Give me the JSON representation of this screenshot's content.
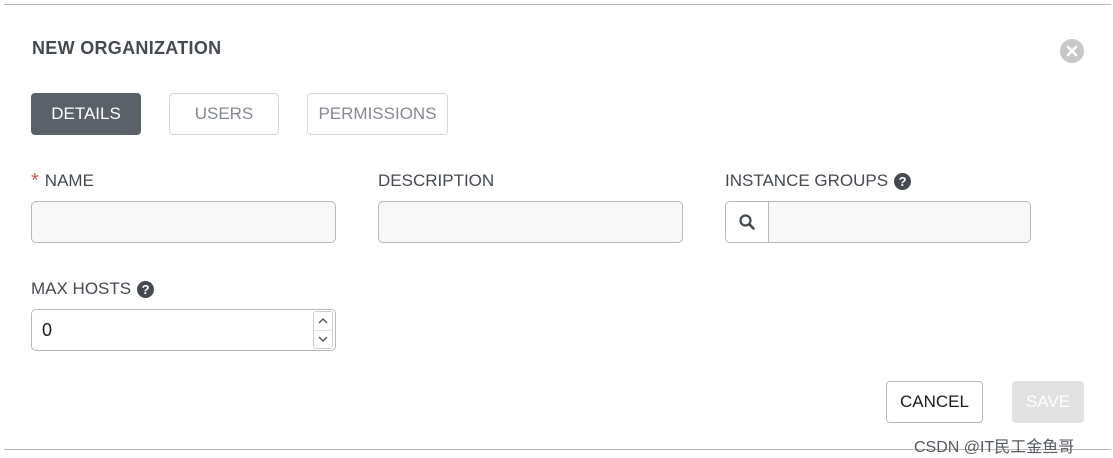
{
  "dialog": {
    "title": "NEW ORGANIZATION",
    "close_icon": "close-circle-icon"
  },
  "tabs": [
    {
      "label": "DETAILS",
      "active": true
    },
    {
      "label": "USERS",
      "active": false
    },
    {
      "label": "PERMISSIONS",
      "active": false
    }
  ],
  "form": {
    "name": {
      "required_marker": "*",
      "label": "NAME",
      "value": ""
    },
    "description": {
      "label": "DESCRIPTION",
      "value": ""
    },
    "instance_groups": {
      "label": "INSTANCE GROUPS",
      "help_icon": "question-circle-icon",
      "lookup_icon": "search-icon",
      "value": ""
    },
    "max_hosts": {
      "label": "MAX HOSTS",
      "help_icon": "question-circle-icon",
      "value": "0"
    }
  },
  "actions": {
    "cancel_label": "CANCEL",
    "save_label": "SAVE",
    "save_enabled": false
  },
  "watermark": "CSDN @IT民工金鱼哥",
  "colors": {
    "active_tab_bg": "#5b6169",
    "required": "#d9534f",
    "disabled_save_bg": "#e1e1e1",
    "text_dark": "#444a50",
    "border": "#b7b7b7"
  }
}
